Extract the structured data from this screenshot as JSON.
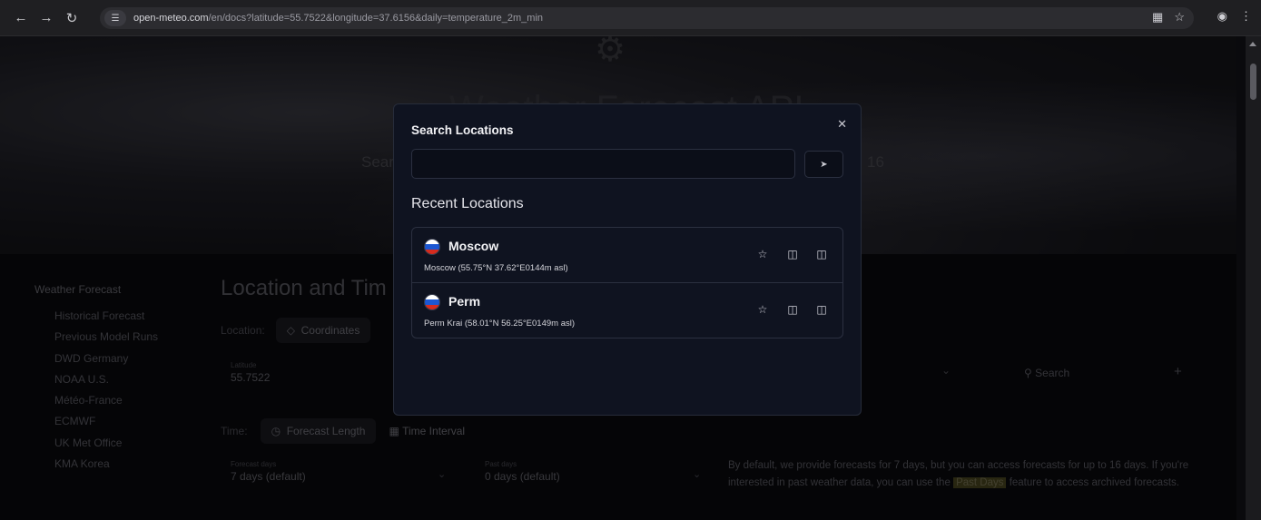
{
  "browser": {
    "url_host": "open-meteo.com",
    "url_rest": "/en/docs?latitude=55.7522&longitude=37.6156&daily=temperature_2m_min",
    "icons": [
      "back-icon",
      "forward-icon",
      "reload-icon",
      "site-info-icon",
      "translate-icon",
      "bookmark-star-icon",
      "profile-icon",
      "menu-icon"
    ]
  },
  "hero": {
    "title": "Weather Forecast API",
    "subtitle_left": "Sear",
    "subtitle_right": "16"
  },
  "sidebar": {
    "heading": "Weather Forecast",
    "items": [
      {
        "label": "Historical Forecast"
      },
      {
        "label": "Previous Model Runs"
      },
      {
        "label": "DWD Germany"
      },
      {
        "label": "NOAA U.S."
      },
      {
        "label": "Météo-France"
      },
      {
        "label": "ECMWF"
      },
      {
        "label": "UK Met Office"
      },
      {
        "label": "KMA Korea"
      }
    ]
  },
  "main": {
    "title": "Location and Tim",
    "location_label": "Location:",
    "coordinates_label": "Coordinates",
    "latitude_label": "Latitude",
    "latitude_value": "55.7522",
    "search_label": "Search",
    "time_label": "Time:",
    "forecast_length_label": "Forecast Length",
    "time_interval_label": "Time Interval",
    "forecast_days_label": "Forecast days",
    "forecast_days_value": "7 days (default)",
    "past_days_label": "Past days",
    "past_days_value": "0 days (default)",
    "description_pre": "By default, we provide forecasts for 7 days, but you can access forecasts for up to 16 days. If you're interested in past weather data, you can use the",
    "description_highlight": "Past Days",
    "description_post": "feature to access archived forecasts."
  },
  "modal": {
    "title": "Search Locations",
    "search_value": "",
    "search_placeholder": "",
    "recent_title": "Recent Locations",
    "locations": [
      {
        "name": "Moscow",
        "detail": "Moscow (55.75°N 37.62°E0144m asl)",
        "flag": "russia-flag"
      },
      {
        "name": "Perm",
        "detail": "Perm Krai (58.01°N 56.25°E0149m asl)",
        "flag": "russia-flag"
      }
    ]
  },
  "colors": {
    "modal_bg": "#0f1320",
    "modal_border": "#272c3a",
    "flag_white": "#ffffff",
    "flag_blue": "#1c57d2",
    "flag_red": "#d52b1e",
    "highlight": "#4a4620"
  }
}
